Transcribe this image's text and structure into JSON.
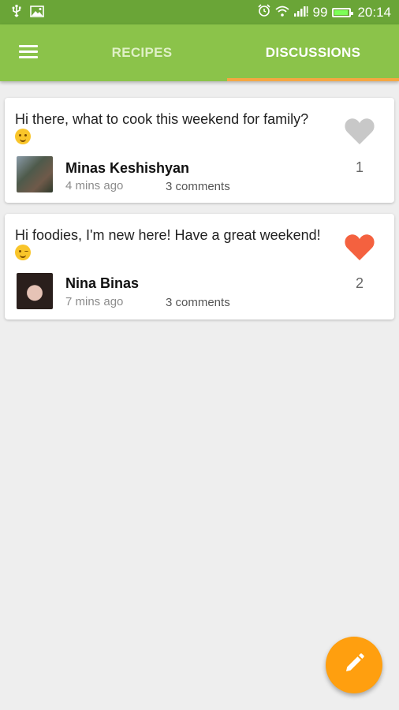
{
  "status_bar": {
    "battery_level": "99",
    "time": "20:14",
    "icons": [
      "usb-icon",
      "image-icon",
      "alarm-icon",
      "wifi-icon",
      "signal-icon",
      "battery-icon"
    ]
  },
  "toolbar": {
    "tabs": [
      {
        "label": "RECIPES",
        "selected": false
      },
      {
        "label": "DISCUSSIONS",
        "selected": true
      }
    ],
    "colors": {
      "bar": "#8bc34a",
      "indicator": "#f5a742",
      "status": "#6aa537"
    }
  },
  "discussions": [
    {
      "message": "Hi there, what to cook this weekend for family?",
      "emoji": "smile-emoji",
      "author": "Minas Keshishyan",
      "time": "4 mins ago",
      "comments": "3 comments",
      "likes": "1",
      "liked": false,
      "heart_color": "#c8c8c8"
    },
    {
      "message": "Hi foodies, I'm new here! Have a great weekend!",
      "emoji": "wink-emoji",
      "author": "Nina Binas",
      "time": "7 mins ago",
      "comments": "3 comments",
      "likes": "2",
      "liked": true,
      "heart_color": "#f4613f"
    }
  ],
  "fab": {
    "icon": "pencil-icon",
    "color": "#ff9f0f"
  }
}
